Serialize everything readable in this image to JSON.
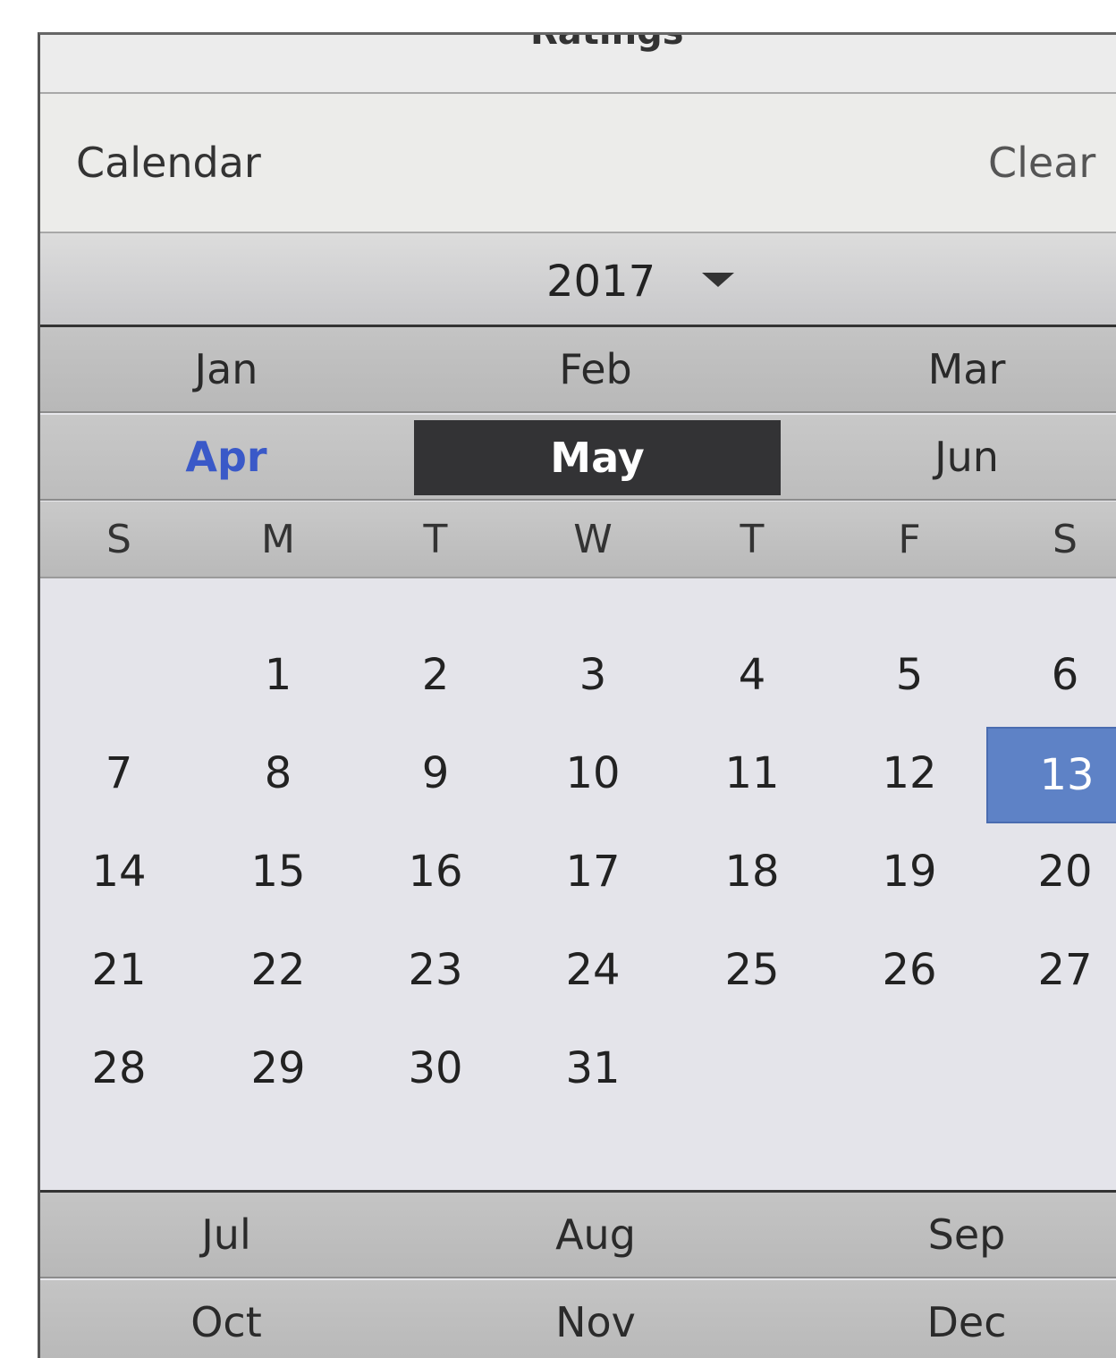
{
  "header": {
    "cut_title": "Ratings"
  },
  "calendar": {
    "title": "Calendar",
    "clear_label": "Clear"
  },
  "year": {
    "value": "2017"
  },
  "months": [
    "Jan",
    "Feb",
    "Mar",
    "Apr",
    "May",
    "Jun",
    "Jul",
    "Aug",
    "Sep",
    "Oct",
    "Nov",
    "Dec"
  ],
  "current_month": "Apr",
  "selected_month": "May",
  "weekdays": [
    "S",
    "M",
    "T",
    "W",
    "T",
    "F",
    "S"
  ],
  "days": [
    [
      "",
      "1",
      "2",
      "3",
      "4",
      "5",
      "6"
    ],
    [
      "7",
      "8",
      "9",
      "10",
      "11",
      "12",
      "13"
    ],
    [
      "14",
      "15",
      "16",
      "17",
      "18",
      "19",
      "20"
    ],
    [
      "21",
      "22",
      "23",
      "24",
      "25",
      "26",
      "27"
    ],
    [
      "28",
      "29",
      "30",
      "31",
      "",
      "",
      ""
    ]
  ],
  "selected_day": "13",
  "colors": {
    "selected_month_bg": "#333335",
    "current_month_text": "#3a59c8",
    "selected_day_bg": "#5e82c6"
  }
}
